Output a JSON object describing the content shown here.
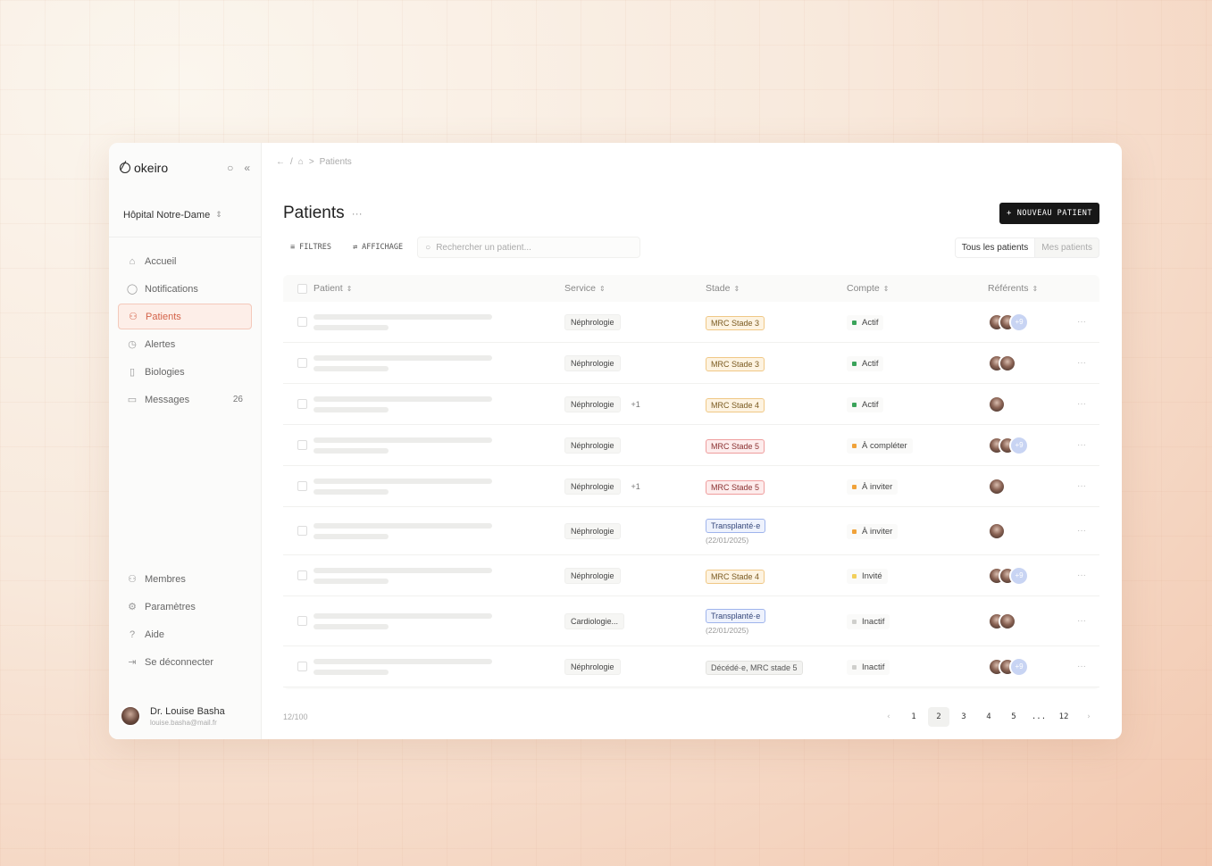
{
  "app": {
    "brand": "okeiro",
    "hospital": "Hôpital Notre-Dame"
  },
  "breadcrumb": {
    "current": "Patients",
    "separator": "/",
    "caret": ">"
  },
  "sidebar": {
    "items": [
      {
        "label": "Accueil",
        "icon": "home-icon"
      },
      {
        "label": "Notifications",
        "icon": "bell-icon"
      },
      {
        "label": "Patients",
        "icon": "user-icon",
        "active": true
      },
      {
        "label": "Alertes",
        "icon": "clock-icon"
      },
      {
        "label": "Biologies",
        "icon": "file-icon"
      },
      {
        "label": "Messages",
        "icon": "message-icon",
        "count": "26"
      }
    ],
    "bottom": [
      {
        "label": "Membres",
        "icon": "user-icon"
      },
      {
        "label": "Paramètres",
        "icon": "gear-icon"
      },
      {
        "label": "Aide",
        "icon": "help-icon"
      },
      {
        "label": "Se déconnecter",
        "icon": "logout-icon"
      }
    ],
    "user": {
      "name": "Dr. Louise Basha",
      "email": "louise.basha@mail.fr"
    }
  },
  "header": {
    "title": "Patients",
    "new_button": "NOUVEAU PATIENT"
  },
  "toolbar": {
    "filters": "FILTRES",
    "display": "AFFICHAGE",
    "search_placeholder": "Rechercher un patient...",
    "seg_all": "Tous les patients",
    "seg_mine": "Mes patients"
  },
  "table": {
    "columns": [
      "Patient",
      "Service",
      "Stade",
      "Compte",
      "Référents"
    ],
    "rows": [
      {
        "service": "Néphrologie",
        "extra": "",
        "stade": "MRC Stade 3",
        "stade_style": "orange",
        "date": "",
        "compte": "Actif",
        "status": "green",
        "refs": "+9"
      },
      {
        "service": "Néphrologie",
        "extra": "",
        "stade": "MRC Stade 3",
        "stade_style": "orange",
        "date": "",
        "compte": "Actif",
        "status": "green",
        "refs": "2"
      },
      {
        "service": "Néphrologie",
        "extra": "+1",
        "stade": "MRC Stade 4",
        "stade_style": "orange",
        "date": "",
        "compte": "Actif",
        "status": "green",
        "refs": "1"
      },
      {
        "service": "Néphrologie",
        "extra": "",
        "stade": "MRC Stade 5",
        "stade_style": "red",
        "date": "",
        "compte": "À compléter",
        "status": "orange",
        "refs": "+9"
      },
      {
        "service": "Néphrologie",
        "extra": "+1",
        "stade": "MRC Stade 5",
        "stade_style": "red",
        "date": "",
        "compte": "À inviter",
        "status": "orange",
        "refs": "1"
      },
      {
        "service": "Néphrologie",
        "extra": "",
        "stade": "Transplanté·e",
        "stade_style": "blue",
        "date": "(22/01/2025)",
        "compte": "À inviter",
        "status": "orange",
        "refs": "1"
      },
      {
        "service": "Néphrologie",
        "extra": "",
        "stade": "MRC Stade 4",
        "stade_style": "orange",
        "date": "",
        "compte": "Invité",
        "status": "yellow",
        "refs": "+9"
      },
      {
        "service": "Cardiologie...",
        "extra": "",
        "stade": "Transplanté·e",
        "stade_style": "blue",
        "date": "(22/01/2025)",
        "compte": "Inactif",
        "status": "grey",
        "refs": "2"
      },
      {
        "service": "Néphrologie",
        "extra": "",
        "stade": "Décédé·e, MRC stade 5",
        "stade_style": "grey",
        "date": "",
        "compte": "Inactif",
        "status": "grey",
        "refs": "+9"
      }
    ]
  },
  "footer": {
    "count": "12/100",
    "pages": [
      "1",
      "2",
      "3",
      "4",
      "5",
      "...",
      "12"
    ],
    "current_page": "2"
  },
  "colors": {
    "accent": "#d4634a",
    "green": "#3aa35a",
    "orange": "#f0a23a",
    "yellow": "#f2cf5b",
    "grey": "#cfcfcc"
  }
}
